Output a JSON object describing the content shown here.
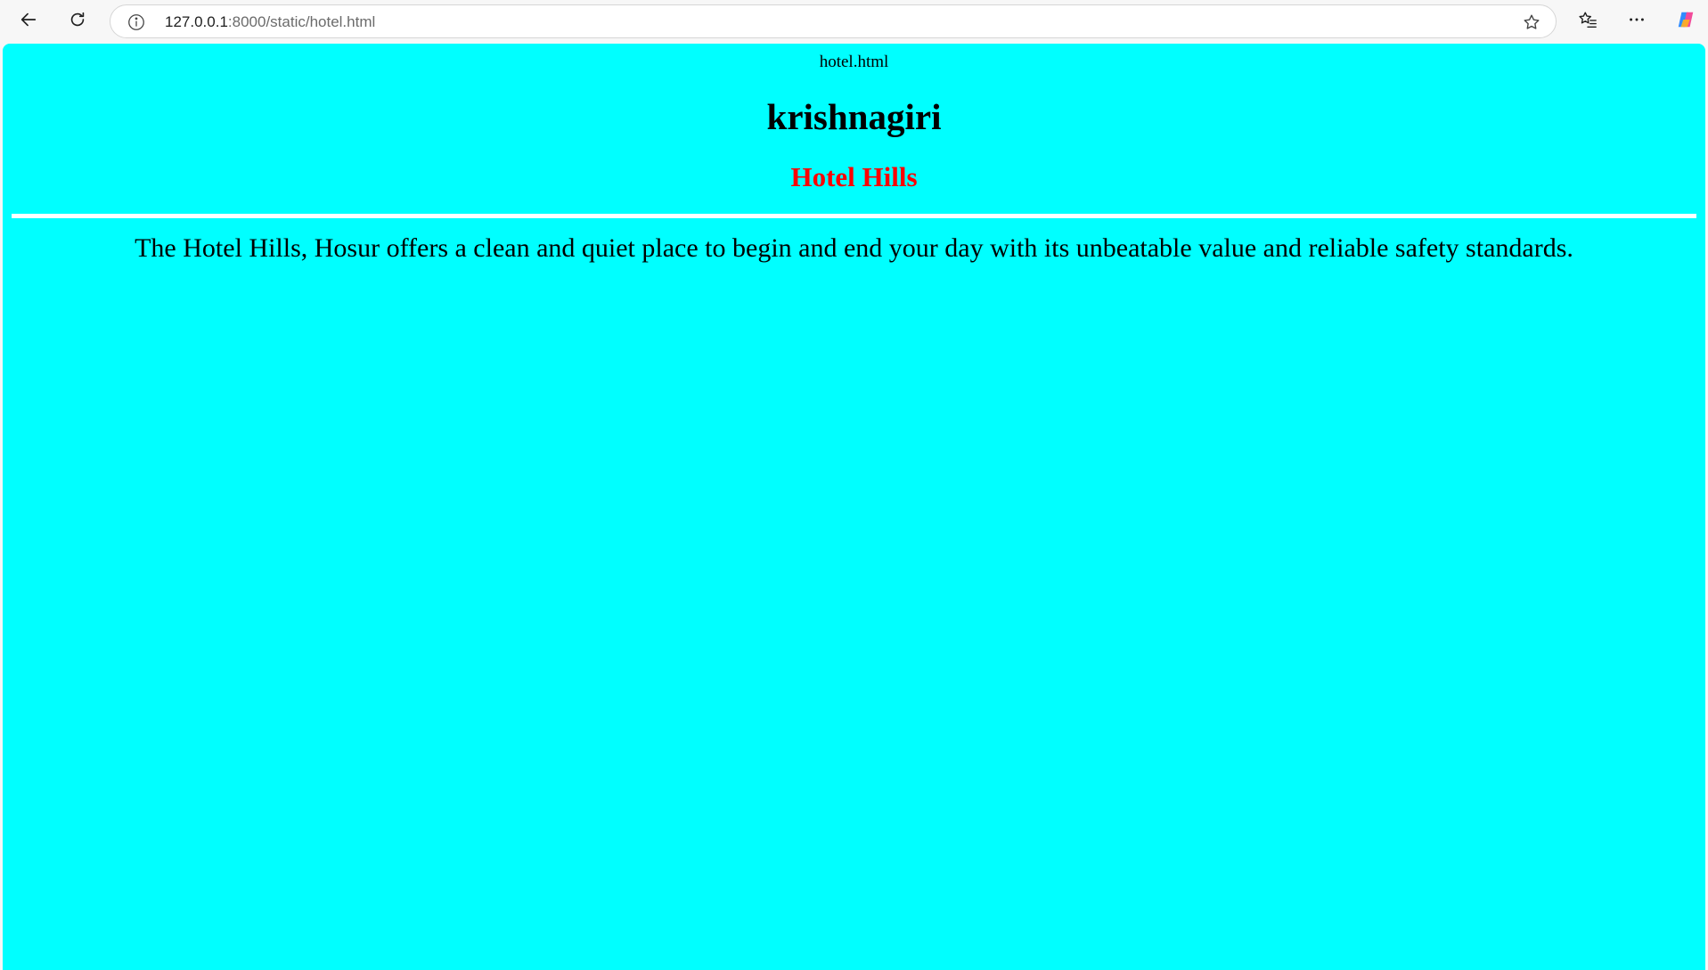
{
  "browser": {
    "url_host": "127.0.0.1",
    "url_rest": ":8000/static/hotel.html",
    "icons": {
      "back": "back-arrow-icon",
      "refresh": "refresh-icon",
      "info": "info-icon",
      "star": "star-icon",
      "favorites": "favorites-icon",
      "more": "more-icon",
      "copilot": "copilot-icon"
    }
  },
  "page": {
    "file_label": "hotel.html",
    "heading": "krishnagiri",
    "hotel_name": "Hotel Hills",
    "description": "The Hotel Hills, Hosur offers a clean and quiet place to begin and end your day with its unbeatable value and reliable safety standards.",
    "colors": {
      "background": "#00ffff",
      "hotel_name": "#ff0000",
      "rule": "#ffffff"
    }
  }
}
